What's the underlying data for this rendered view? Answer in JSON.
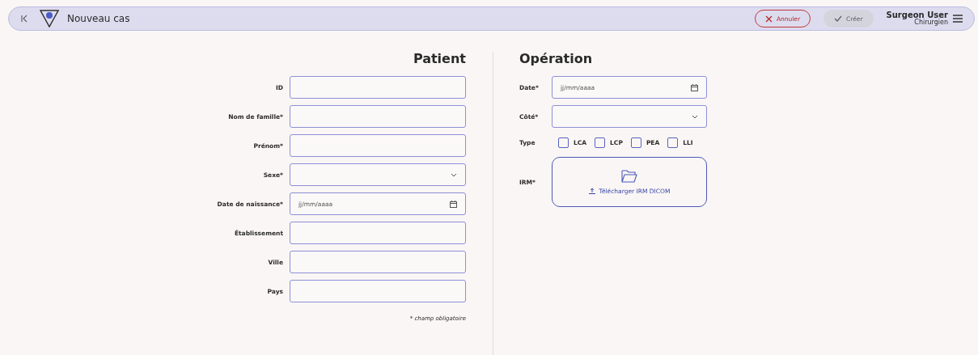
{
  "header": {
    "title": "Nouveau cas",
    "buttons": [
      {
        "kind": "cancel",
        "label": "Annuler",
        "disabled": false
      },
      {
        "kind": "confirm",
        "label": "Créer",
        "disabled": true
      }
    ],
    "user": {
      "name": "Surgeon User",
      "role": "Chirurgien"
    }
  },
  "patient": {
    "title": "Patient",
    "fields": [
      {
        "label": "ID",
        "kind": "text"
      },
      {
        "label": "Nom de famille*",
        "kind": "text"
      },
      {
        "label": "Prénom*",
        "kind": "text"
      },
      {
        "label": "Sexe*",
        "kind": "select"
      },
      {
        "label": "Date de naissance*",
        "kind": "date",
        "placeholder": "jj/mm/aaaa"
      },
      {
        "label": "Établissement",
        "kind": "text"
      },
      {
        "label": "Ville",
        "kind": "text"
      },
      {
        "label": "Pays",
        "kind": "text"
      }
    ],
    "note": "* champ obligatoire"
  },
  "operation": {
    "title": "Opération",
    "fields": [
      {
        "label": "Date*",
        "kind": "date",
        "placeholder": "jj/mm/aaaa"
      },
      {
        "label": "Côté*",
        "kind": "select"
      },
      {
        "label": "Type",
        "kind": "checkboxes",
        "options": [
          {
            "label": "LCA",
            "checked": false
          },
          {
            "label": "LCP",
            "checked": false
          },
          {
            "label": "PEA",
            "checked": false
          },
          {
            "label": "LLI",
            "checked": false
          }
        ]
      },
      {
        "label": "IRM*",
        "kind": "upload",
        "text": "Télécharger IRM DICOM"
      }
    ]
  }
}
